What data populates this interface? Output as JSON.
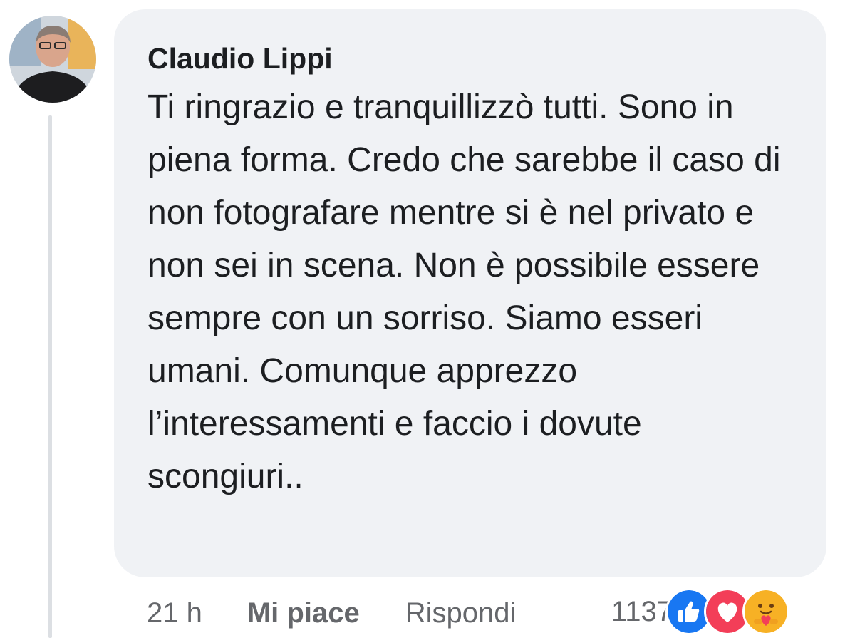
{
  "comment": {
    "author": "Claudio Lippi",
    "text": "Ti ringrazio e tranquillizzò tutti. Sono in piena forma. Credo che sarebbe il caso di non fotografare mentre si è nel privato e non sei in scena. Non è possibile essere sempre con un sorriso. Siamo esseri umani. Comunque apprezzo l’interessamenti e faccio i dovute scongiuri..",
    "avatar_icon": "user-avatar"
  },
  "actions": {
    "time": "21 h",
    "like_label": "Mi piace",
    "reply_label": "Rispondi"
  },
  "reactions": {
    "count": "1137",
    "icons": [
      "like-icon",
      "love-icon",
      "care-icon"
    ],
    "colors": {
      "like": "#1877f2",
      "love": "#f33e58",
      "care": "#f7b125"
    }
  }
}
